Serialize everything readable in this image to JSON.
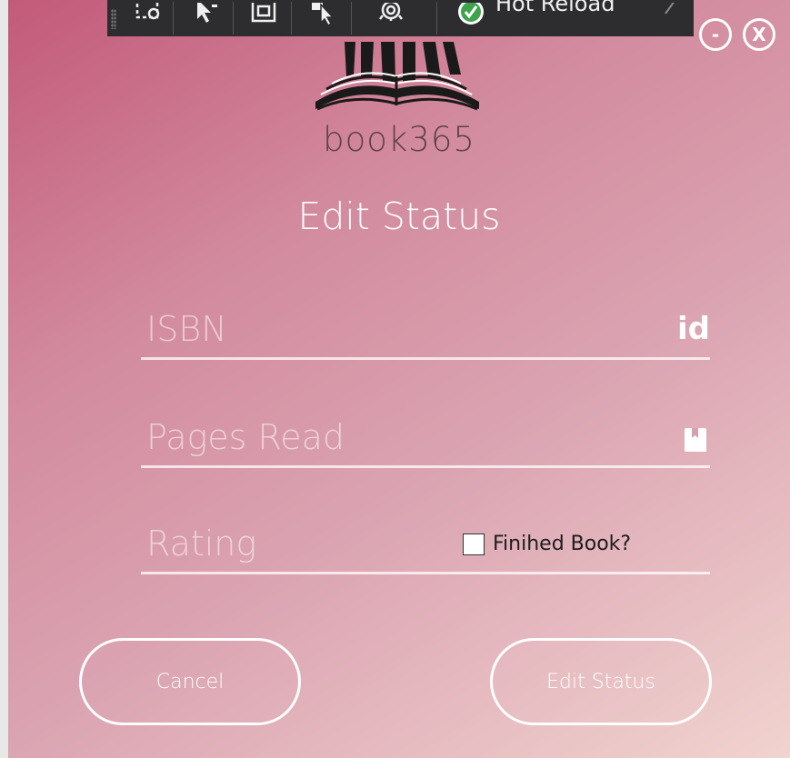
{
  "toolbar": {
    "hot_reload_label": "Hot Reload",
    "icons": [
      "select-element-icon",
      "pointer-icon",
      "layout-icon",
      "track-focus-icon",
      "settings-icon",
      "check-icon"
    ]
  },
  "window_controls": {
    "minimize_label": "-",
    "close_label": "X"
  },
  "brand": {
    "name": "book365"
  },
  "form": {
    "title": "Edit Status",
    "isbn_placeholder": "ISBN",
    "isbn_icon_text": "id",
    "pages_placeholder": "Pages Read",
    "rating_placeholder": "Rating",
    "finished_label": "Finihed Book?",
    "finished_checked": false
  },
  "buttons": {
    "cancel_label": "Cancel",
    "submit_label": "Edit Status"
  },
  "colors": {
    "gradient_start": "#c35a7a",
    "gradient_end": "#f1d3cf",
    "accent": "#ffffff",
    "toolbar_bg": "#2d2d30",
    "brand_text": "#5d4048"
  }
}
